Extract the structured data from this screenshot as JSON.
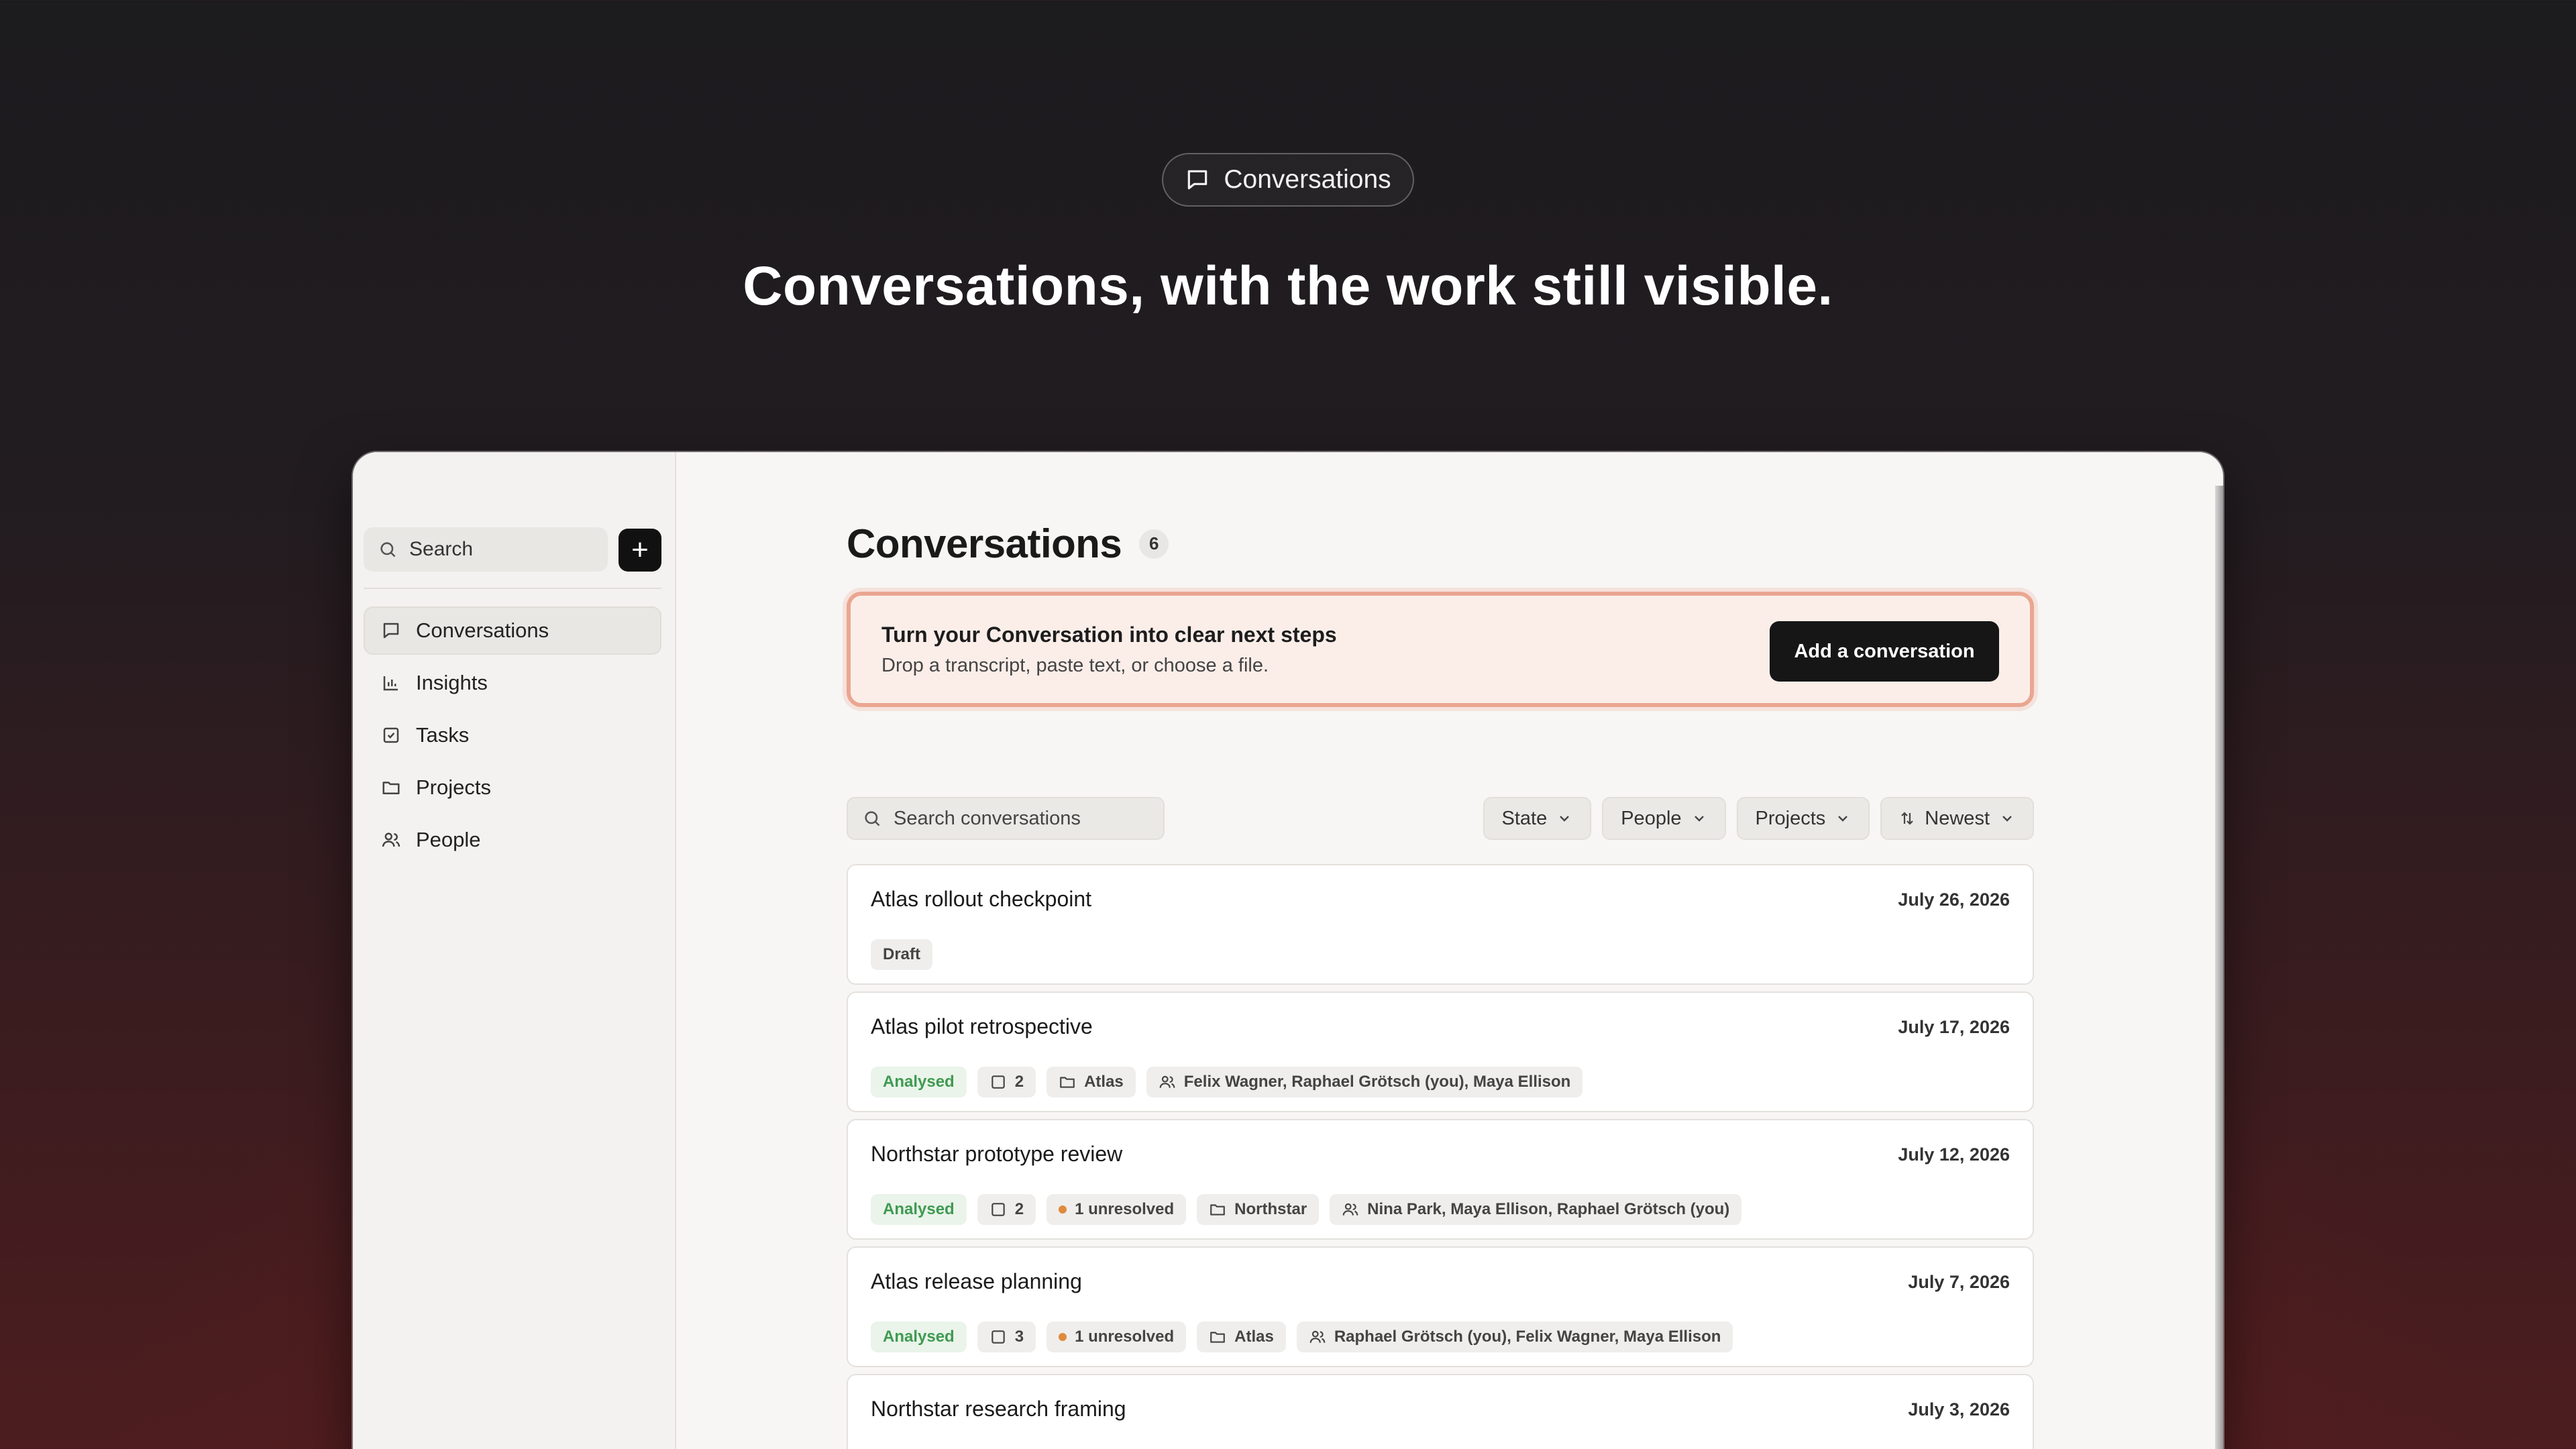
{
  "hero": {
    "pill_label": "Conversations",
    "title": "Conversations, with the work still visible."
  },
  "sidebar": {
    "search_placeholder": "Search",
    "add_label": "+",
    "items": [
      {
        "label": "Conversations",
        "icon": "chat-icon",
        "active": true
      },
      {
        "label": "Insights",
        "icon": "bar-chart-icon"
      },
      {
        "label": "Tasks",
        "icon": "checkbox-icon"
      },
      {
        "label": "Projects",
        "icon": "folder-icon"
      },
      {
        "label": "People",
        "icon": "people-icon"
      }
    ]
  },
  "main": {
    "title": "Conversations",
    "count": "6",
    "cta": {
      "title": "Turn your Conversation into clear next steps",
      "subtitle": "Drop a transcript, paste text, or choose a file.",
      "button": "Add a conversation"
    },
    "search_placeholder": "Search conversations",
    "filters": {
      "state": "State",
      "people": "People",
      "projects": "Projects",
      "sort": "Newest"
    },
    "rows": [
      {
        "title": "Atlas rollout checkpoint",
        "date": "July 26, 2026",
        "status": "Draft"
      },
      {
        "title": "Atlas pilot retrospective",
        "date": "July 17, 2026",
        "status": "Analysed",
        "tasks": "2",
        "project": "Atlas",
        "people": "Felix Wagner, Raphael Grötsch (you), Maya Ellison"
      },
      {
        "title": "Northstar prototype review",
        "date": "July 12, 2026",
        "status": "Analysed",
        "tasks": "2",
        "unresolved": "1 unresolved",
        "project": "Northstar",
        "people": "Nina Park, Maya Ellison, Raphael Grötsch (you)"
      },
      {
        "title": "Atlas release planning",
        "date": "July 7, 2026",
        "status": "Analysed",
        "tasks": "3",
        "unresolved": "1 unresolved",
        "project": "Atlas",
        "people": "Raphael Grötsch (you), Felix Wagner, Maya Ellison"
      },
      {
        "title": "Northstar research framing",
        "date": "July 3, 2026"
      }
    ]
  }
}
